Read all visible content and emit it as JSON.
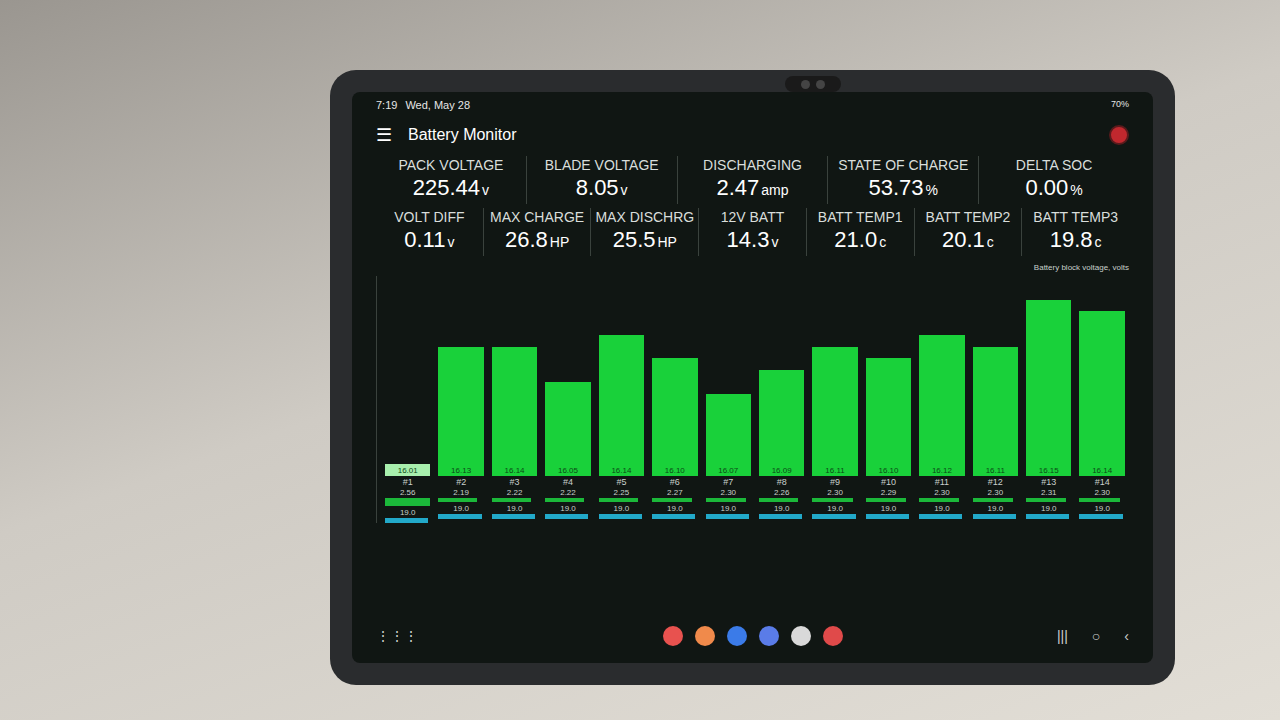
{
  "status_bar": {
    "time": "7:19",
    "date": "Wed, May 28",
    "battery": "70%"
  },
  "app_bar": {
    "menu_icon": "☰",
    "title": "Battery Monitor",
    "recording": true
  },
  "stats": [
    [
      {
        "label": "PACK VOLTAGE",
        "value": "225.44",
        "unit": "v"
      },
      {
        "label": "BLADE VOLTAGE",
        "value": "8.05",
        "unit": "v"
      },
      {
        "label": "DISCHARGING",
        "value": "2.47",
        "unit": "amp"
      },
      {
        "label": "STATE OF CHARGE",
        "value": "53.73",
        "unit": "%"
      },
      {
        "label": "DELTA SOC",
        "value": "0.00",
        "unit": "%"
      }
    ],
    [
      {
        "label": "VOLT DIFF",
        "value": "0.11",
        "unit": "v"
      },
      {
        "label": "MAX CHARGE",
        "value": "26.8",
        "unit": "HP"
      },
      {
        "label": "MAX DISCHRG",
        "value": "25.5",
        "unit": "HP"
      },
      {
        "label": "12V BATT",
        "value": "14.3",
        "unit": "v"
      },
      {
        "label": "BATT TEMP1",
        "value": "21.0",
        "unit": "c"
      },
      {
        "label": "BATT TEMP2",
        "value": "20.1",
        "unit": "c"
      },
      {
        "label": "BATT TEMP3",
        "value": "19.8",
        "unit": "c"
      }
    ]
  ],
  "chart": {
    "title": "Battery block voltage, volts",
    "blades": [
      {
        "label": "#1",
        "voltage": 16.01,
        "voltage_text": "16.01",
        "highlighted": true,
        "resistance": 2.56,
        "resistance_text": "2.56",
        "temperature": 19.0,
        "temperature_text": "19.0"
      },
      {
        "label": "#2",
        "voltage": 16.11,
        "voltage_text": "16.13",
        "highlighted": false,
        "resistance": 2.19,
        "resistance_text": "2.19",
        "temperature": 19.0,
        "temperature_text": "19.0"
      },
      {
        "label": "#3",
        "voltage": 16.11,
        "voltage_text": "16.14",
        "highlighted": false,
        "resistance": 2.22,
        "resistance_text": "2.22",
        "temperature": 19.0,
        "temperature_text": "19.0"
      },
      {
        "label": "#4",
        "voltage": 16.08,
        "voltage_text": "16.05",
        "highlighted": false,
        "resistance": 2.22,
        "resistance_text": "2.22",
        "temperature": 19.0,
        "temperature_text": "19.0"
      },
      {
        "label": "#5",
        "voltage": 16.12,
        "voltage_text": "16.14",
        "highlighted": false,
        "resistance": 2.25,
        "resistance_text": "2.25",
        "temperature": 19.0,
        "temperature_text": "19.0"
      },
      {
        "label": "#6",
        "voltage": 16.1,
        "voltage_text": "16.10",
        "highlighted": false,
        "resistance": 2.27,
        "resistance_text": "2.27",
        "temperature": 19.0,
        "temperature_text": "19.0"
      },
      {
        "label": "#7",
        "voltage": 16.07,
        "voltage_text": "16.07",
        "highlighted": false,
        "resistance": 2.3,
        "resistance_text": "2.30",
        "temperature": 19.0,
        "temperature_text": "19.0"
      },
      {
        "label": "#8",
        "voltage": 16.09,
        "voltage_text": "16.09",
        "highlighted": false,
        "resistance": 2.26,
        "resistance_text": "2.26",
        "temperature": 19.0,
        "temperature_text": "19.0"
      },
      {
        "label": "#9",
        "voltage": 16.11,
        "voltage_text": "16.11",
        "highlighted": false,
        "resistance": 2.3,
        "resistance_text": "2.30",
        "temperature": 19.0,
        "temperature_text": "19.0"
      },
      {
        "label": "#10",
        "voltage": 16.1,
        "voltage_text": "16.10",
        "highlighted": false,
        "resistance": 2.29,
        "resistance_text": "2.29",
        "temperature": 19.0,
        "temperature_text": "19.0"
      },
      {
        "label": "#11",
        "voltage": 16.12,
        "voltage_text": "16.12",
        "highlighted": false,
        "resistance": 2.3,
        "resistance_text": "2.30",
        "temperature": 19.0,
        "temperature_text": "19.0"
      },
      {
        "label": "#12",
        "voltage": 16.11,
        "voltage_text": "16.11",
        "highlighted": false,
        "resistance": 2.3,
        "resistance_text": "2.30",
        "temperature": 19.0,
        "temperature_text": "19.0"
      },
      {
        "label": "#13",
        "voltage": 16.15,
        "voltage_text": "16.15",
        "highlighted": false,
        "resistance": 2.31,
        "resistance_text": "2.31",
        "temperature": 19.0,
        "temperature_text": "19.0"
      },
      {
        "label": "#14",
        "voltage": 16.14,
        "voltage_text": "16.14",
        "highlighted": false,
        "resistance": 2.3,
        "resistance_text": "2.30",
        "temperature": 19.0,
        "temperature_text": "19.0"
      }
    ]
  },
  "dock": {
    "apps": [
      {
        "color": "#e8524f"
      },
      {
        "color": "#f08a4b"
      },
      {
        "color": "#3b7be8"
      },
      {
        "color": "#5a7ce8"
      },
      {
        "color": "#d9d9d9"
      },
      {
        "color": "#e04a4a"
      }
    ]
  },
  "nav": {
    "drawer": "⋮⋮⋮",
    "recents": "|||",
    "home": "○",
    "back": "‹"
  }
}
